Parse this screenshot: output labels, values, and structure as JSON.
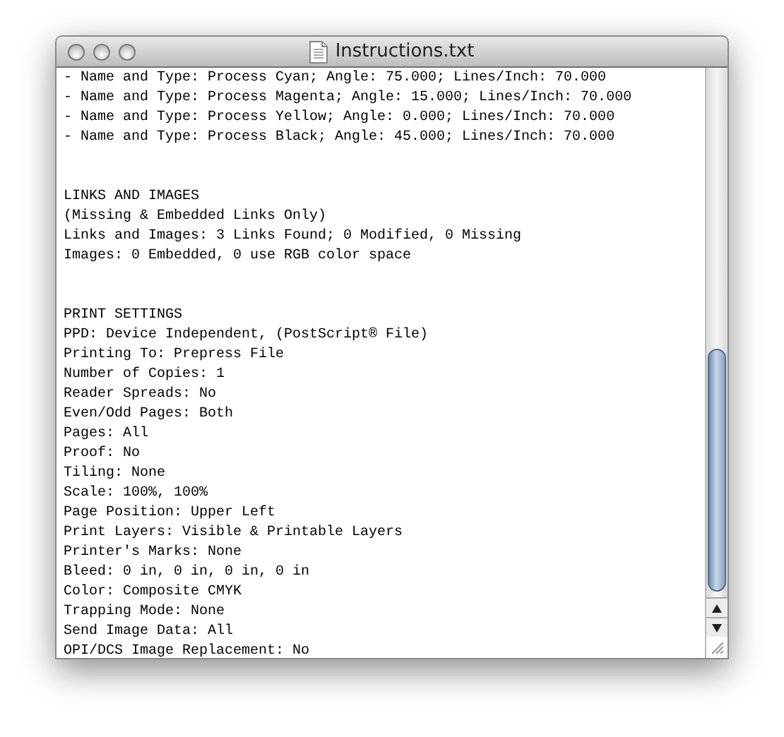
{
  "window": {
    "title": "Instructions.txt"
  },
  "document": {
    "sections": [
      {
        "lines": [
          "- Name and Type: Process Cyan; Angle: 75.000; Lines/Inch: 70.000",
          "- Name and Type: Process Magenta; Angle: 15.000; Lines/Inch: 70.000",
          "- Name and Type: Process Yellow; Angle: 0.000; Lines/Inch: 70.000",
          "- Name and Type: Process Black; Angle: 45.000; Lines/Inch: 70.000"
        ]
      },
      {
        "lines": [
          "LINKS AND IMAGES",
          "(Missing & Embedded Links Only)",
          "Links and Images: 3 Links Found; 0 Modified, 0 Missing",
          "Images: 0 Embedded, 0 use RGB color space"
        ]
      },
      {
        "lines": [
          "PRINT SETTINGS",
          "PPD: Device Independent, (PostScript® File)",
          "Printing To: Prepress File",
          "Number of Copies: 1",
          "Reader Spreads: No",
          "Even/Odd Pages: Both",
          "Pages: All",
          "Proof: No",
          "Tiling: None",
          "Scale: 100%, 100%",
          "Page Position: Upper Left",
          "Print Layers: Visible & Printable Layers",
          "Printer's Marks: None",
          "Bleed: 0 in, 0 in, 0 in, 0 in",
          "Color: Composite CMYK",
          "Trapping Mode: None",
          "Send Image Data: All",
          "OPI/DCS Image Replacement: No"
        ]
      }
    ]
  }
}
